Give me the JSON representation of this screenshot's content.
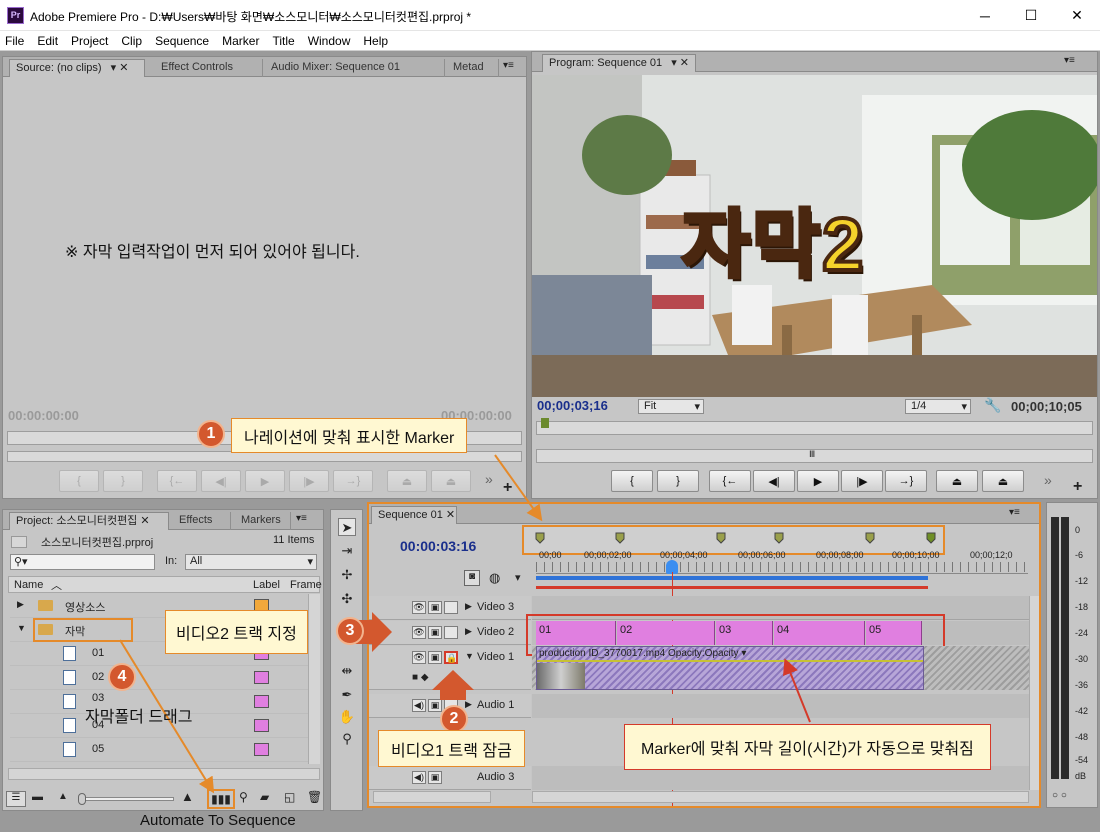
{
  "window": {
    "title": "Adobe Premiere Pro - D:₩Users₩바탕 화면₩소스모니터₩소스모니터컷편집.prproj *",
    "app_icon": "Pr",
    "minimize": "─",
    "maximize": "☐",
    "close": "✕"
  },
  "menu": [
    "File",
    "Edit",
    "Project",
    "Clip",
    "Sequence",
    "Marker",
    "Title",
    "Window",
    "Help"
  ],
  "source_panel": {
    "tabs": [
      "Source: (no clips)",
      "Effect Controls",
      "Audio Mixer: Sequence 01",
      "Metad"
    ],
    "message": "※ 자막 입력작업이 먼저 되어 있어야 됩니다.",
    "timecode": "00:00:00:00",
    "timecode_right": "00:00:00:00"
  },
  "program_panel": {
    "tab": "Program: Sequence 01",
    "overlay_text": "자막2",
    "timecode": "00;00;03;16",
    "fit": "Fit",
    "resolution": "1/4",
    "duration": "00;00;10;05"
  },
  "project_panel": {
    "tabs": [
      "Project: 소스모니터컷편집",
      "Effects",
      "Markers"
    ],
    "file": "소스모니터컷편집.prproj",
    "count": "11 Items",
    "in_label": "In:",
    "in_value": "All",
    "columns": {
      "name": "Name",
      "label": "Label",
      "frame": "Frame"
    },
    "items": [
      {
        "name": "영상소스",
        "type": "folder",
        "color": "#f1a83b"
      },
      {
        "name": "자막",
        "type": "folder",
        "color": "#e07fe0"
      },
      {
        "name": "01",
        "type": "file",
        "color": "#e07fe0"
      },
      {
        "name": "02",
        "type": "file",
        "color": "#e07fe0"
      },
      {
        "name": "03",
        "type": "file",
        "color": "#e07fe0"
      },
      {
        "name": "04",
        "type": "file",
        "color": "#e07fe0"
      },
      {
        "name": "05",
        "type": "file",
        "color": "#e07fe0"
      }
    ]
  },
  "sequence_panel": {
    "tab": "Sequence 01",
    "timecode": "00:00:03:16",
    "ruler": [
      "00;00",
      "00;00;02;00",
      "00;00;04;00",
      "00;00;06;00",
      "00;00;08;00",
      "00;00;10;00",
      "00;00;12;0"
    ],
    "tracks": {
      "v3": "Video 3",
      "v2": "Video 2",
      "v1": "Video 1",
      "a1": "Audio 1",
      "a3": "Audio 3"
    },
    "clips_v2": [
      "01",
      "02",
      "03",
      "04",
      "05"
    ],
    "clip_v1": "production ID_3770017.mp4  Opacity:Opacity ▾"
  },
  "audio_meter": {
    "scale": [
      "0",
      "-6",
      "-12",
      "-18",
      "-24",
      "-30",
      "-36",
      "-42",
      "-48",
      "-54",
      "dB"
    ]
  },
  "annotations": {
    "c1": "나레이션에 맞춰 표시한 Marker",
    "c2": "비디오1 트랙 잠금",
    "c3": "비디오2 트랙 지정",
    "c4": "자막폴더 드래그",
    "c5": "Marker에 맞춰 자막 길이(시간)가 자동으로 맞춰짐",
    "n1": "1",
    "n2": "2",
    "n3": "3",
    "n4": "4"
  },
  "tooltip": "Automate To Sequence",
  "transport": {
    "mark_in": "{",
    "mark_out": "}",
    "goto_in": "{←",
    "step_back": "◀|",
    "play": "▶",
    "step_fwd": "|▶",
    "goto_out": "→}",
    "lift": "⏏",
    "extract": "⏏",
    "more": "»",
    "add": "+"
  },
  "colors": {
    "accent": "#e58a2a",
    "clip": "#e07fe0",
    "badge": "#d3582e",
    "timecode": "#1a2f8c"
  }
}
